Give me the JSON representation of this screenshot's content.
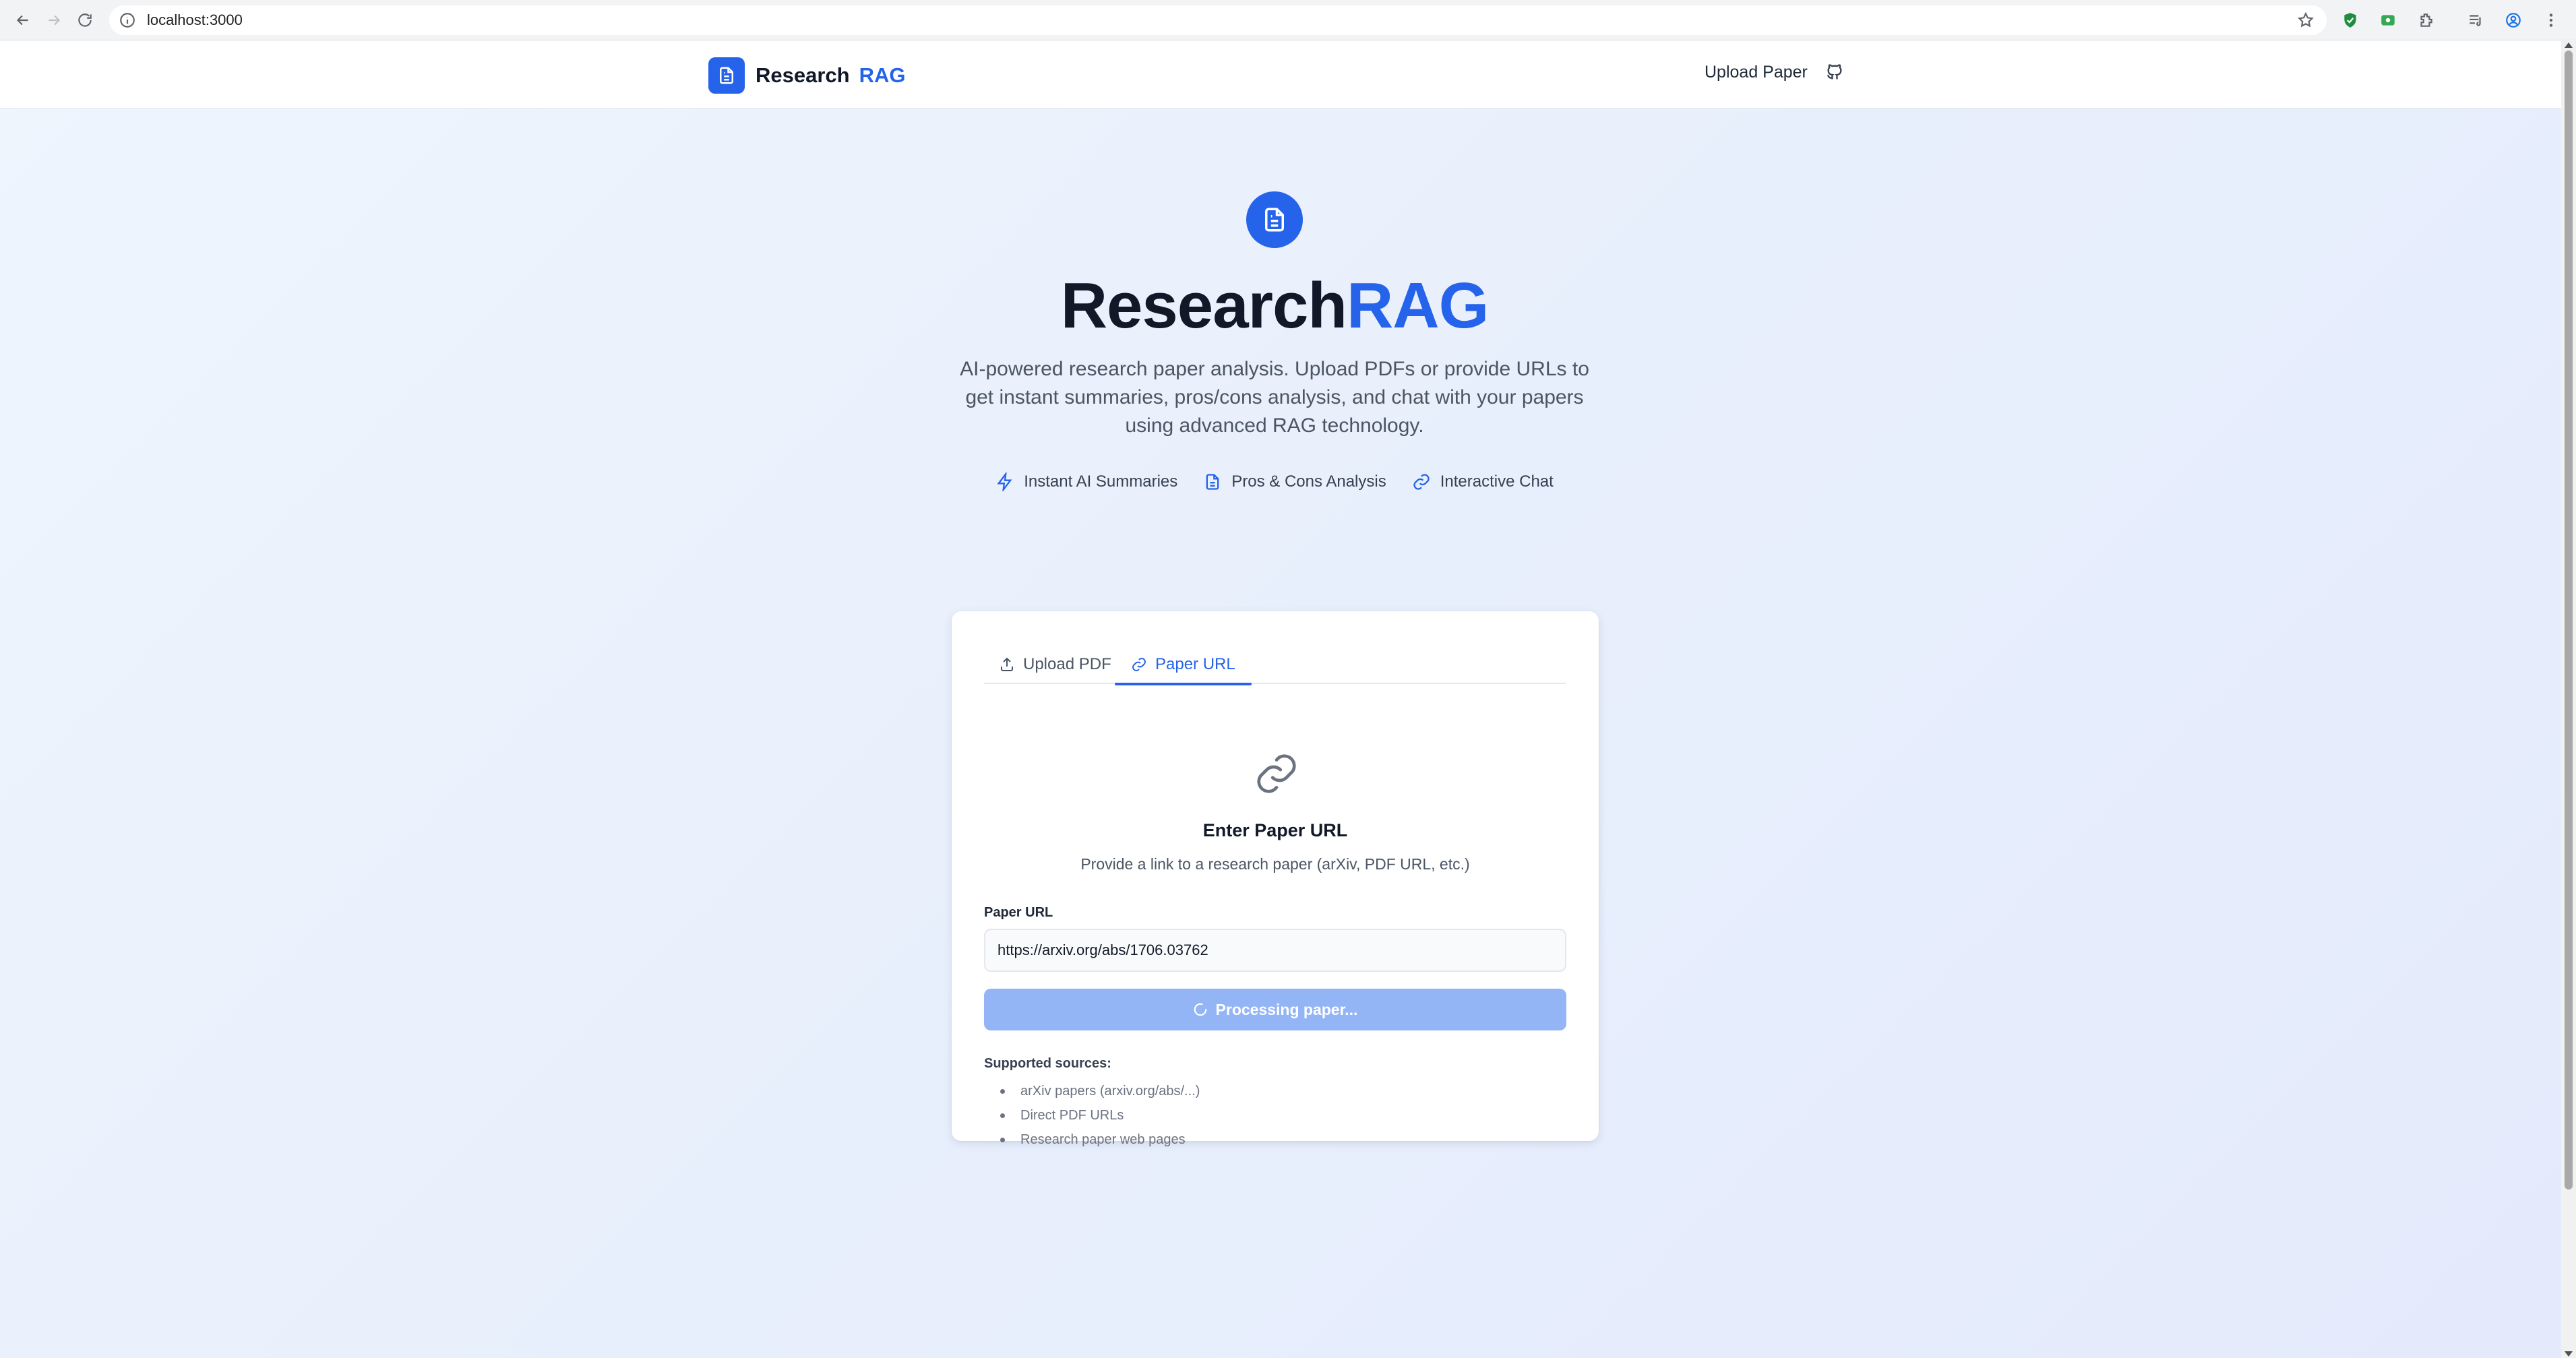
{
  "browser": {
    "url": "localhost:3000",
    "icons": [
      "back-arrow-icon",
      "forward-arrow-icon",
      "reload-icon",
      "site-info-icon",
      "bookmark-star-icon",
      "shield-extension-icon",
      "green-extension-icon",
      "puzzle-extensions-icon",
      "media-control-icon",
      "profile-icon",
      "more-menu-icon"
    ]
  },
  "header": {
    "brand_text": "Research",
    "brand_accent": "RAG",
    "upload_link": "Upload Paper",
    "icons": [
      "document-icon",
      "github-icon"
    ]
  },
  "hero": {
    "title_main": "Research",
    "title_accent": "RAG",
    "description": "AI-powered research paper analysis. Upload PDFs or provide URLs to get instant summaries, pros/cons analysis, and chat with your papers using advanced RAG technology.",
    "features": [
      {
        "label": "Instant AI Summaries",
        "icon": "lightning-icon"
      },
      {
        "label": "Pros & Cons Analysis",
        "icon": "document-icon"
      },
      {
        "label": "Interactive Chat",
        "icon": "link-icon"
      }
    ]
  },
  "card": {
    "tabs": [
      {
        "label": "Upload PDF",
        "icon": "upload-icon",
        "active": false
      },
      {
        "label": "Paper URL",
        "icon": "link-icon",
        "active": true
      }
    ],
    "title": "Enter Paper URL",
    "subtitle": "Provide a link to a research paper (arXiv, PDF URL, etc.)",
    "field_label": "Paper URL",
    "url_value": "https://arxiv.org/abs/1706.03762",
    "button_label": "Processing paper...",
    "sources_title": "Supported sources:",
    "sources": [
      "arXiv papers (arxiv.org/abs/...)",
      "Direct PDF URLs",
      "Research paper web pages"
    ]
  },
  "colors": {
    "accent": "#2563eb",
    "button_disabled": "#93b4f5",
    "background": "#eaf0fc"
  }
}
